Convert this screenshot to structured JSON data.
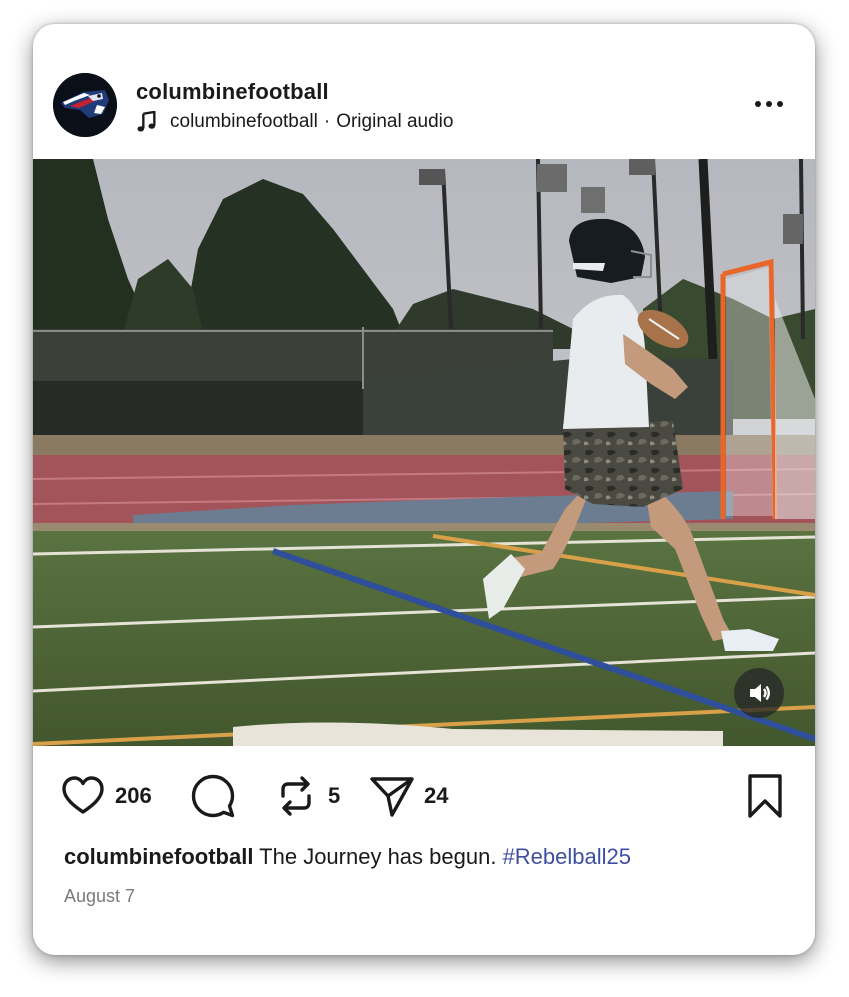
{
  "post": {
    "header": {
      "username": "columbinefootball",
      "audio_owner": "columbinefootball",
      "audio_separator": "·",
      "audio_title": "Original audio",
      "avatar_icon": "patriot-logo-icon",
      "more_icon": "more-options-icon"
    },
    "media": {
      "type": "video",
      "sound_icon": "speaker-icon"
    },
    "actions": {
      "likes": "206",
      "reposts": "5",
      "shares": "24",
      "icons": [
        "heart-icon",
        "comment-icon",
        "repost-icon",
        "send-icon",
        "bookmark-icon"
      ]
    },
    "caption": {
      "username": "columbinefootball",
      "text": " The Journey has begun. ",
      "hashtag": "#Rebelball25"
    },
    "date": "August 7"
  },
  "colors": {
    "hashtag": "#3f4fa0",
    "text": "#1a1a1a",
    "secondary": "#7a7a7a",
    "goal_frame": "#e8662a",
    "field_line_blue": "#2f4f9a",
    "track": "#a3545a",
    "turf": "#4f6a3a"
  }
}
